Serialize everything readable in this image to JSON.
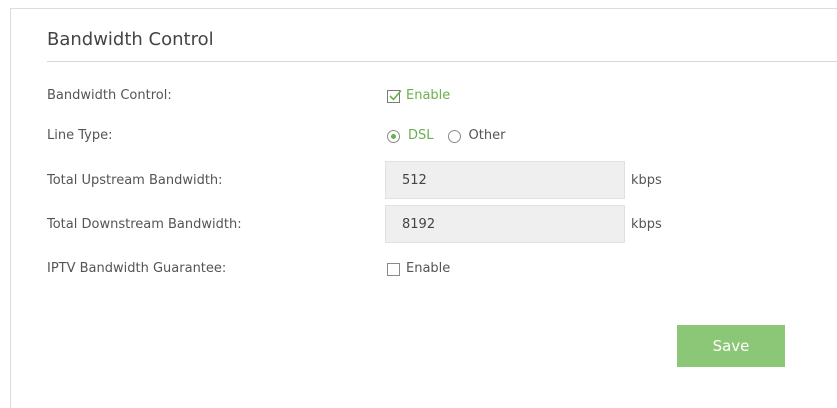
{
  "section": {
    "title": "Bandwidth Control"
  },
  "bandwidth_control": {
    "label": "Bandwidth Control:",
    "checkbox_label": "Enable",
    "checked": true
  },
  "line_type": {
    "label": "Line Type:",
    "options": [
      {
        "label": "DSL",
        "selected": true
      },
      {
        "label": "Other",
        "selected": false
      }
    ]
  },
  "upstream": {
    "label": "Total Upstream Bandwidth:",
    "value": "512",
    "unit": "kbps"
  },
  "downstream": {
    "label": "Total Downstream Bandwidth:",
    "value": "8192",
    "unit": "kbps"
  },
  "iptv": {
    "label": "IPTV Bandwidth Guarantee:",
    "checkbox_label": "Enable",
    "checked": false
  },
  "actions": {
    "save_label": "Save"
  },
  "colors": {
    "accent": "#6ab04c",
    "button": "#8cc777",
    "input_bg": "#efefef"
  }
}
